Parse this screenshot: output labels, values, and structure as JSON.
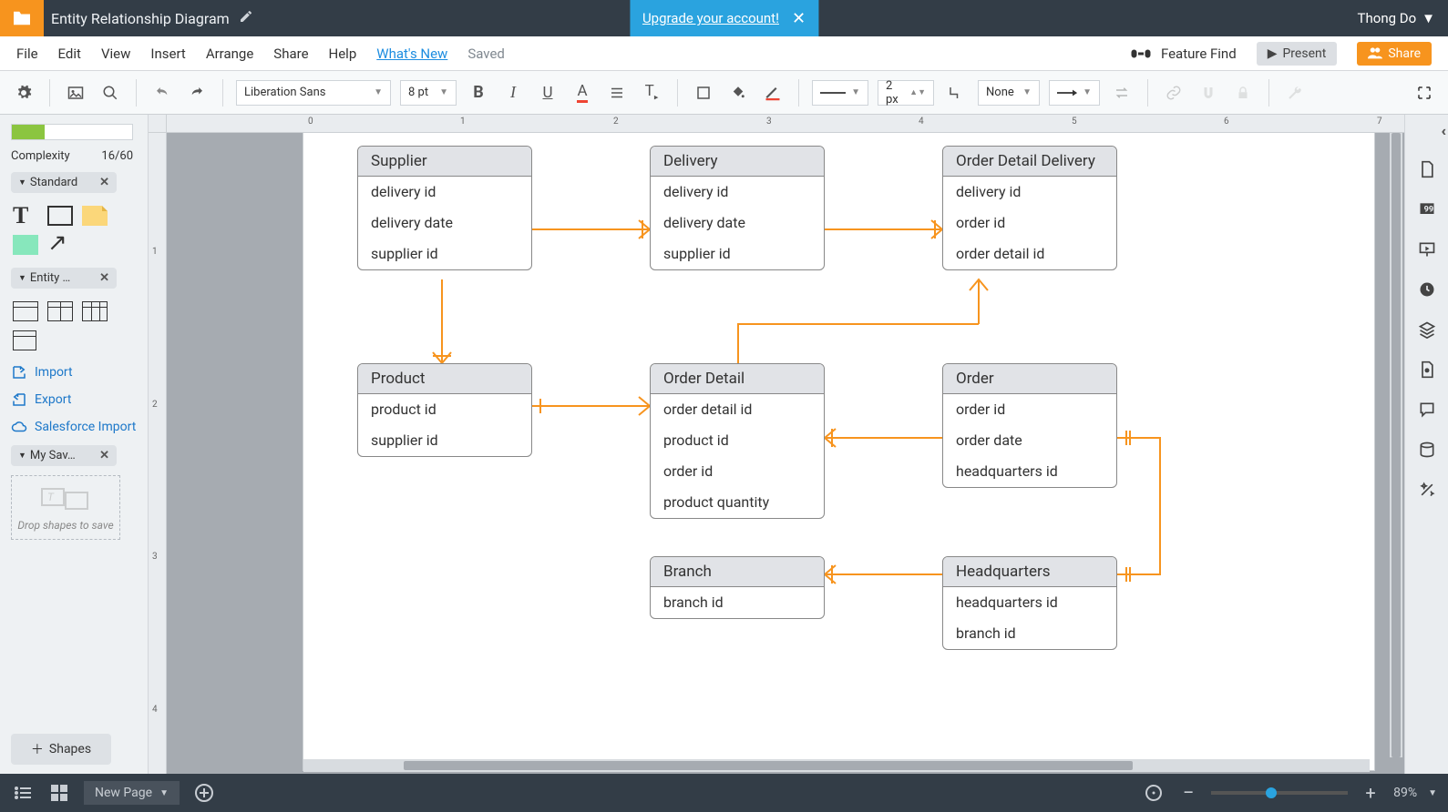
{
  "topbar": {
    "doc_title": "Entity Relationship Diagram",
    "upgrade_text": "Upgrade your account!",
    "user_name": "Thong Do"
  },
  "menu": {
    "items": [
      "File",
      "Edit",
      "View",
      "Insert",
      "Arrange",
      "Share",
      "Help"
    ],
    "whats_new": "What's New",
    "saved": "Saved",
    "feature_find": "Feature Find",
    "present": "Present",
    "share": "Share"
  },
  "toolbar": {
    "font": "Liberation Sans",
    "font_size": "8 pt",
    "line_width": "2 px",
    "line_style": "None"
  },
  "left": {
    "complexity_label": "Complexity",
    "complexity_value": "16/60",
    "group_standard": "Standard",
    "group_entity": "Entity …",
    "import": "Import",
    "export": "Export",
    "salesforce": "Salesforce Import",
    "group_saved": "My Sav…",
    "drop_text": "Drop shapes to save",
    "shapes_btn": "Shapes"
  },
  "ruler": {
    "h": [
      "0",
      "1",
      "2",
      "3",
      "4",
      "5",
      "6",
      "7"
    ],
    "v": [
      "1",
      "2",
      "3",
      "4"
    ]
  },
  "entities": {
    "supplier": {
      "title": "Supplier",
      "fields": [
        "delivery id",
        "delivery date",
        "supplier id"
      ]
    },
    "delivery": {
      "title": "Delivery",
      "fields": [
        "delivery id",
        "delivery date",
        "supplier id"
      ]
    },
    "odd": {
      "title": "Order Detail Delivery",
      "fields": [
        "delivery id",
        "order id",
        "order detail id"
      ]
    },
    "product": {
      "title": "Product",
      "fields": [
        "product id",
        "supplier id"
      ]
    },
    "orderdetail": {
      "title": "Order Detail",
      "fields": [
        "order detail id",
        "product id",
        "order id",
        "product quantity"
      ]
    },
    "order": {
      "title": "Order",
      "fields": [
        "order id",
        "order date",
        "headquarters id"
      ]
    },
    "branch": {
      "title": "Branch",
      "fields": [
        "branch id"
      ]
    },
    "hq": {
      "title": "Headquarters",
      "fields": [
        "headquarters id",
        "branch id"
      ]
    }
  },
  "bottom": {
    "new_page": "New Page",
    "zoom": "89%"
  },
  "chart_data": {
    "type": "erd",
    "entities": [
      {
        "id": "supplier",
        "name": "Supplier",
        "attributes": [
          "delivery id",
          "delivery date",
          "supplier id"
        ]
      },
      {
        "id": "delivery",
        "name": "Delivery",
        "attributes": [
          "delivery id",
          "delivery date",
          "supplier id"
        ]
      },
      {
        "id": "order_detail_delivery",
        "name": "Order Detail Delivery",
        "attributes": [
          "delivery id",
          "order id",
          "order detail id"
        ]
      },
      {
        "id": "product",
        "name": "Product",
        "attributes": [
          "product id",
          "supplier id"
        ]
      },
      {
        "id": "order_detail",
        "name": "Order Detail",
        "attributes": [
          "order detail id",
          "product id",
          "order id",
          "product quantity"
        ]
      },
      {
        "id": "order",
        "name": "Order",
        "attributes": [
          "order id",
          "order date",
          "headquarters id"
        ]
      },
      {
        "id": "branch",
        "name": "Branch",
        "attributes": [
          "branch id"
        ]
      },
      {
        "id": "headquarters",
        "name": "Headquarters",
        "attributes": [
          "headquarters id",
          "branch id"
        ]
      }
    ],
    "relationships": [
      {
        "from": "supplier",
        "to": "delivery",
        "from_card": "one",
        "to_card": "many"
      },
      {
        "from": "delivery",
        "to": "order_detail_delivery",
        "from_card": "one",
        "to_card": "many"
      },
      {
        "from": "supplier",
        "to": "product",
        "from_card": "one",
        "to_card": "many"
      },
      {
        "from": "product",
        "to": "order_detail",
        "from_card": "one",
        "to_card": "many"
      },
      {
        "from": "order_detail",
        "to": "order_detail_delivery",
        "from_card": "one",
        "to_card": "many"
      },
      {
        "from": "order_detail",
        "to": "order",
        "from_card": "many",
        "to_card": "one"
      },
      {
        "from": "branch",
        "to": "headquarters",
        "from_card": "many",
        "to_card": "one"
      },
      {
        "from": "order",
        "to": "headquarters",
        "from_card": "many",
        "to_card": "one"
      }
    ]
  }
}
